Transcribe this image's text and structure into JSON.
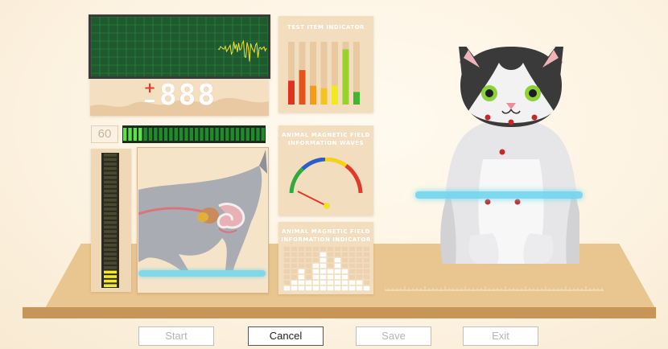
{
  "counter": {
    "sign": "+",
    "digits": "888",
    "scale_value": "60"
  },
  "panels": {
    "test_item": {
      "title": "Test Item Indicator",
      "bars": [
        {
          "level": 0.38,
          "color": "#e2331e"
        },
        {
          "level": 0.55,
          "color": "#e4541c"
        },
        {
          "level": 0.3,
          "color": "#f59a1c"
        },
        {
          "level": 0.26,
          "color": "#f6c21b"
        },
        {
          "level": 0.3,
          "color": "#f2ea20"
        },
        {
          "level": 0.88,
          "color": "#9ad12a"
        },
        {
          "level": 0.2,
          "color": "#3fb62f"
        }
      ]
    },
    "waves": {
      "title_line1": "Animal magnetic field",
      "title_line2": "information waves"
    },
    "indicator": {
      "title_line1": "Animal magnetic field",
      "title_line2": "information Indicator",
      "columns": [
        0.15,
        0.3,
        0.45,
        0.3,
        0.65,
        0.85,
        0.45,
        0.75,
        0.5,
        0.3,
        0.3,
        0.15
      ]
    }
  },
  "meters": {
    "horizontal_lit": 4,
    "horizontal_total": 28,
    "vertical_lit": 4,
    "vertical_total": 30
  },
  "buttons": {
    "start": "Start",
    "cancel": "Cancel",
    "save": "Save",
    "exit": "Exit"
  },
  "colors": {
    "accent_green": "#2fd12f",
    "panel": "#f3ddbf",
    "table": "#e9c68f",
    "scan_beam": "#6fd6ee"
  }
}
